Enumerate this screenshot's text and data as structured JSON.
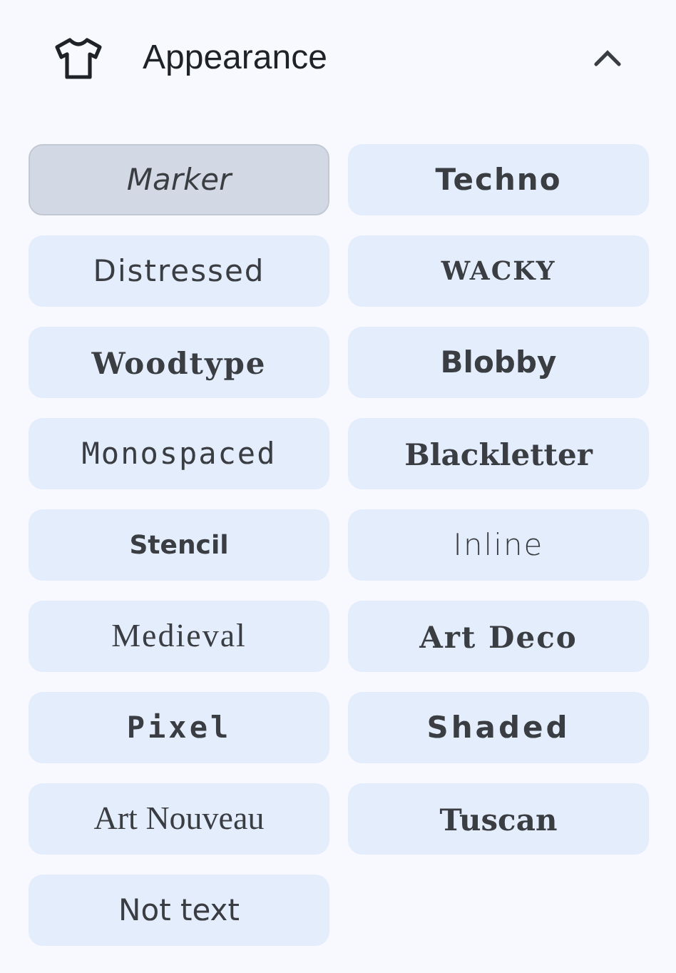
{
  "section": {
    "title": "Appearance",
    "expanded": true
  },
  "fonts": [
    {
      "label": "Marker",
      "selected": true
    },
    {
      "label": "Techno",
      "selected": false
    },
    {
      "label": "Distressed",
      "selected": false
    },
    {
      "label": "WACKY",
      "selected": false
    },
    {
      "label": "Woodtype",
      "selected": false
    },
    {
      "label": "Blobby",
      "selected": false
    },
    {
      "label": "Monospaced",
      "selected": false
    },
    {
      "label": "Blackletter",
      "selected": false
    },
    {
      "label": "Stencil",
      "selected": false
    },
    {
      "label": "Inline",
      "selected": false
    },
    {
      "label": "Medieval",
      "selected": false
    },
    {
      "label": "Art Deco",
      "selected": false
    },
    {
      "label": "Pixel",
      "selected": false
    },
    {
      "label": "Shaded",
      "selected": false
    },
    {
      "label": "Art Nouveau",
      "selected": false
    },
    {
      "label": "Tuscan",
      "selected": false
    },
    {
      "label": "Not text",
      "selected": false
    }
  ]
}
